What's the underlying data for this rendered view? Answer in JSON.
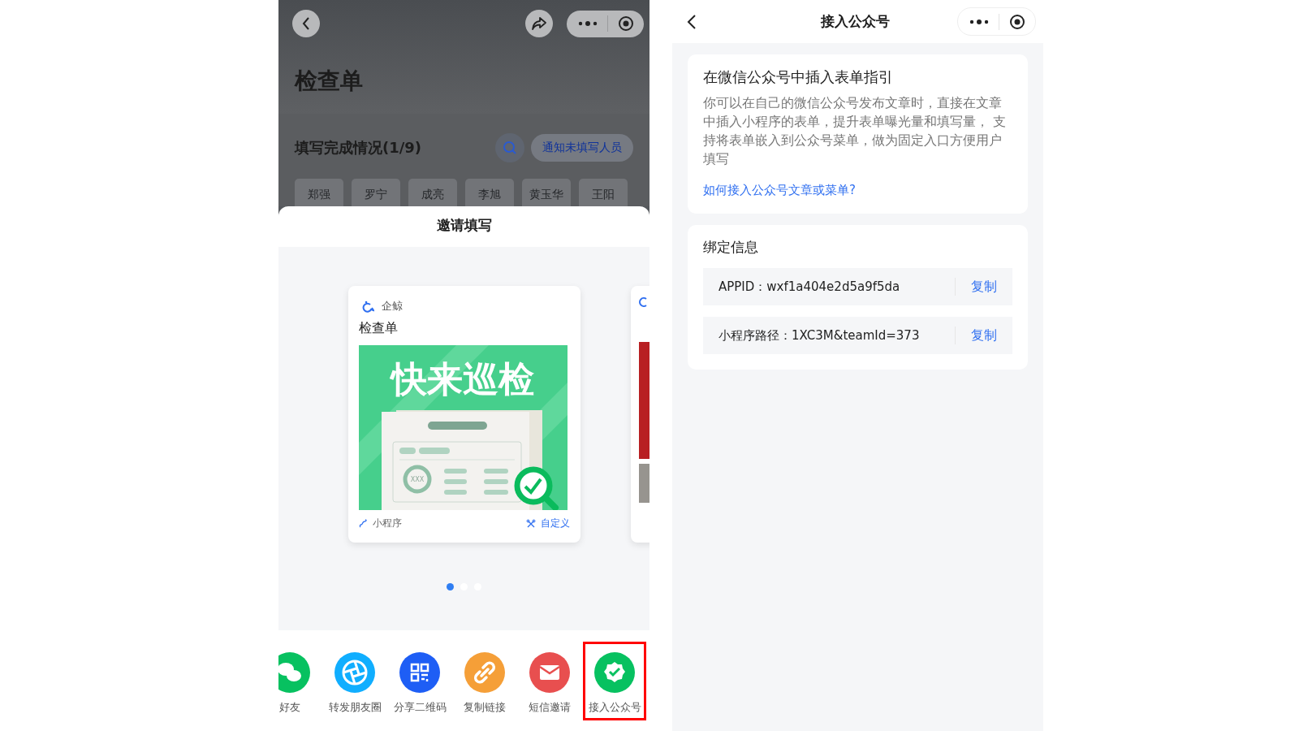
{
  "left_screen": {
    "page_title": "检查单",
    "progress_title": "填写完成情况(1/9)",
    "notify_button": "通知未填写人员",
    "members": [
      "郑强",
      "罗宁",
      "成亮",
      "李旭",
      "黄玉华",
      "王阳"
    ],
    "sheet": {
      "title": "邀请填写",
      "cards": [
        {
          "kind": "poster",
          "brand": "企鲸",
          "title": "检查单",
          "poster_text": "快来巡检",
          "gauge_text": "XXX",
          "type_label": "小程序",
          "customize_label": "自定义"
        },
        {
          "kind": "partial"
        }
      ],
      "dots": [
        {
          "selected": true
        },
        {
          "selected": false
        },
        {
          "selected": false
        }
      ],
      "share_items": [
        {
          "kind": "wechat",
          "label": "好友",
          "highlighted": false
        },
        {
          "kind": "moments",
          "label": "转发朋友圈",
          "highlighted": false
        },
        {
          "kind": "qrcode",
          "label": "分享二维码",
          "highlighted": false
        },
        {
          "kind": "link",
          "label": "复制链接",
          "highlighted": false
        },
        {
          "kind": "sms",
          "label": "短信邀请",
          "highlighted": false
        },
        {
          "kind": "official",
          "label": "接入公众号",
          "highlighted": true
        }
      ]
    }
  },
  "right_screen": {
    "nav_title": "接入公众号",
    "guide": {
      "title": "在微信公众号中插入表单指引",
      "body": "你可以在自己的微信公众号发布文章时，直接在文章中插入小程序的表单，提升表单曝光量和填写量， 支持将表单嵌入到公众号菜单，做为固定入口方便用户填写",
      "link": "如何接入公众号文章或菜单?"
    },
    "binding": {
      "title": "绑定信息",
      "rows": [
        {
          "label": "APPID：wxf1a404e2d5a9f5da",
          "action": "复制"
        },
        {
          "label": "小程序路径：1XC3M&teamId=373",
          "action": "复制"
        }
      ]
    }
  }
}
